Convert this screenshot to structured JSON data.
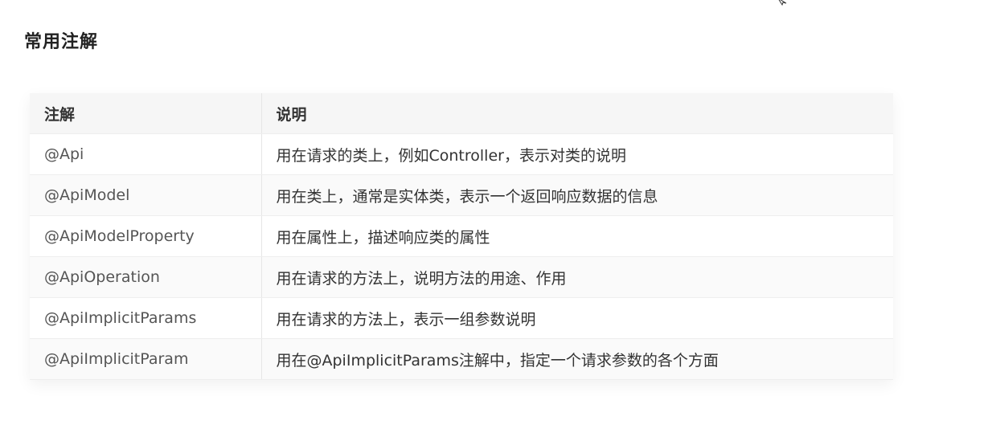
{
  "page": {
    "title": "常用注解"
  },
  "table": {
    "headers": [
      "注解",
      "说明"
    ],
    "rows": [
      {
        "annotation": "@Api",
        "description": "用在请求的类上，例如Controller，表示对类的说明"
      },
      {
        "annotation": "@ApiModel",
        "description": "用在类上，通常是实体类，表示一个返回响应数据的信息"
      },
      {
        "annotation": "@ApiModelProperty",
        "description": "用在属性上，描述响应类的属性"
      },
      {
        "annotation": "@ApiOperation",
        "description": "用在请求的方法上，说明方法的用途、作用"
      },
      {
        "annotation": "@ApiImplicitParams",
        "description": "用在请求的方法上，表示一组参数说明"
      },
      {
        "annotation": "@ApiImplicitParam",
        "description": "用在@ApiImplicitParams注解中，指定一个请求参数的各个方面"
      }
    ]
  },
  "icons": {
    "cursor": "mouse-cursor-icon"
  }
}
